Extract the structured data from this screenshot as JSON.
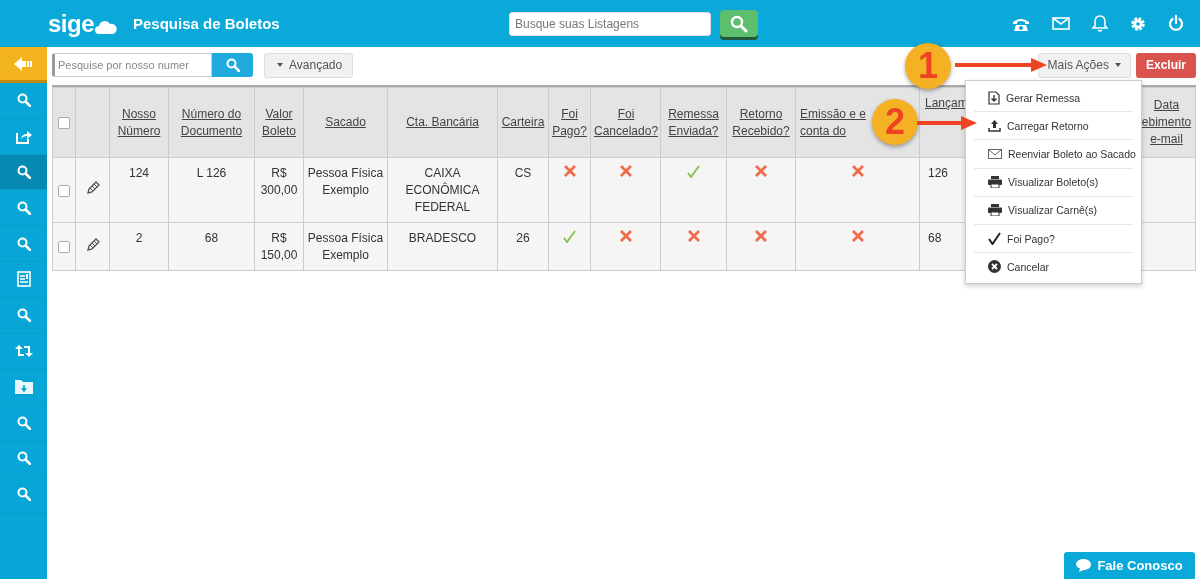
{
  "header": {
    "logo": "sige",
    "title": "Pesquisa de Boletos",
    "search": {
      "placeholder": "Busque suas Listagens"
    }
  },
  "sidebar": {
    "items": [
      {
        "selected": false
      },
      {
        "selected": false
      },
      {
        "selected": true
      },
      {
        "selected": false
      },
      {
        "selected": false
      },
      {
        "selected": false
      },
      {
        "selected": false
      },
      {
        "selected": false
      },
      {
        "selected": false
      },
      {
        "selected": false
      },
      {
        "selected": false
      },
      {
        "selected": false
      }
    ]
  },
  "toolbar": {
    "search": {
      "placeholder": "Pesquise por nosso numer"
    },
    "advanced": "Avançado",
    "more_actions": "Mais Ações",
    "delete": "Excluir"
  },
  "table": {
    "select_all": {
      "checked": false
    },
    "columns": [
      "Nosso Número",
      "Número do Documento",
      "Valor Boleto",
      "Sacado",
      "Cta. Bancária",
      "Carteira",
      "Foi Pago?",
      "Foi Cancelado?",
      "Remessa Enviada?",
      "Retorno Recebido?",
      "Emissão e e\nconta do",
      "Lançam",
      "Data\nebimento\ne-mail"
    ],
    "rows": [
      {
        "checked": false,
        "cells": [
          {
            "kind": "text",
            "text": "124"
          },
          {
            "kind": "text",
            "text": "L 126"
          },
          {
            "kind": "text",
            "text": "R$ 300,00"
          },
          {
            "kind": "text",
            "text": "Pessoa Física Exemplo"
          },
          {
            "kind": "text",
            "text": "CAIXA ECONÔMICA FEDERAL"
          },
          {
            "kind": "text",
            "text": "CS"
          },
          {
            "kind": "status",
            "ok": false
          },
          {
            "kind": "status",
            "ok": false
          },
          {
            "kind": "status",
            "ok": true
          },
          {
            "kind": "status",
            "ok": false
          },
          {
            "kind": "status",
            "ok": false
          },
          {
            "kind": "text",
            "text": "126"
          }
        ]
      },
      {
        "checked": false,
        "cells": [
          {
            "kind": "text",
            "text": "2"
          },
          {
            "kind": "text",
            "text": "68"
          },
          {
            "kind": "text",
            "text": "R$ 150,00"
          },
          {
            "kind": "text",
            "text": "Pessoa Física Exemplo"
          },
          {
            "kind": "text",
            "text": "BRADESCO"
          },
          {
            "kind": "text",
            "text": "26"
          },
          {
            "kind": "status",
            "ok": true
          },
          {
            "kind": "status",
            "ok": false
          },
          {
            "kind": "status",
            "ok": false
          },
          {
            "kind": "status",
            "ok": false
          },
          {
            "kind": "status",
            "ok": false
          },
          {
            "kind": "text",
            "text": "68"
          }
        ]
      }
    ]
  },
  "menu": {
    "items": [
      "Gerar Remessa",
      "Carregar Retorno",
      "Reenviar Boleto ao Sacado",
      "Visualizar Boleto(s)",
      "Visualizar Carnê(s)",
      "Foi Pago?",
      "Cancelar"
    ]
  },
  "steps": [
    "1",
    "2"
  ],
  "chat": "Fale Conosco"
}
